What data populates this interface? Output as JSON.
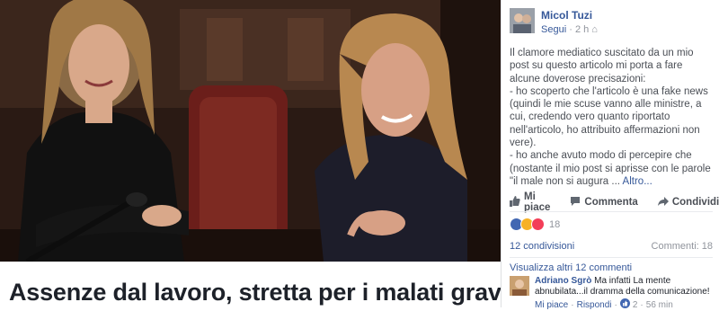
{
  "article": {
    "headline": "Assenze dal lavoro, stretta per i malati gravi: “Chi fa"
  },
  "post": {
    "author": "Micol Tuzi",
    "follow_label": "Segui",
    "time": "2 h",
    "text_lines": [
      "Il clamore mediatico suscitato da un mio post su questo articolo mi porta a fare alcune doverose precisazioni:",
      "- ho scoperto che l'articolo è una fake news (quindi le mie scuse vanno alle ministre, a cui, credendo vero quanto riportato nell'articolo, ho attribuito affermazioni non vere).",
      "- ho anche avuto modo di percepire che (nostante il mio post si aprisse con le parole \"il male non si augura ..."
    ],
    "more_label": "Altro..."
  },
  "actions": {
    "like_label": "Mi piace",
    "comment_label": "Commenta",
    "share_label": "Condividi"
  },
  "reactions": {
    "count": "18",
    "shares": "12 condivisioni",
    "comments": "Commenti: 18"
  },
  "comments": {
    "view_more": "Visualizza altri 12 commenti",
    "items": [
      {
        "author": "Adriano Sgrò",
        "text": "Ma infatti La mente abnubilata...il dramma della comunicazione!",
        "like_label": "Mi piace",
        "reply_label": "Rispondi",
        "likes": "2",
        "time": "56 min"
      }
    ]
  },
  "colors": {
    "link": "#365899",
    "text": "#4b4f56",
    "muted": "#90949c"
  }
}
